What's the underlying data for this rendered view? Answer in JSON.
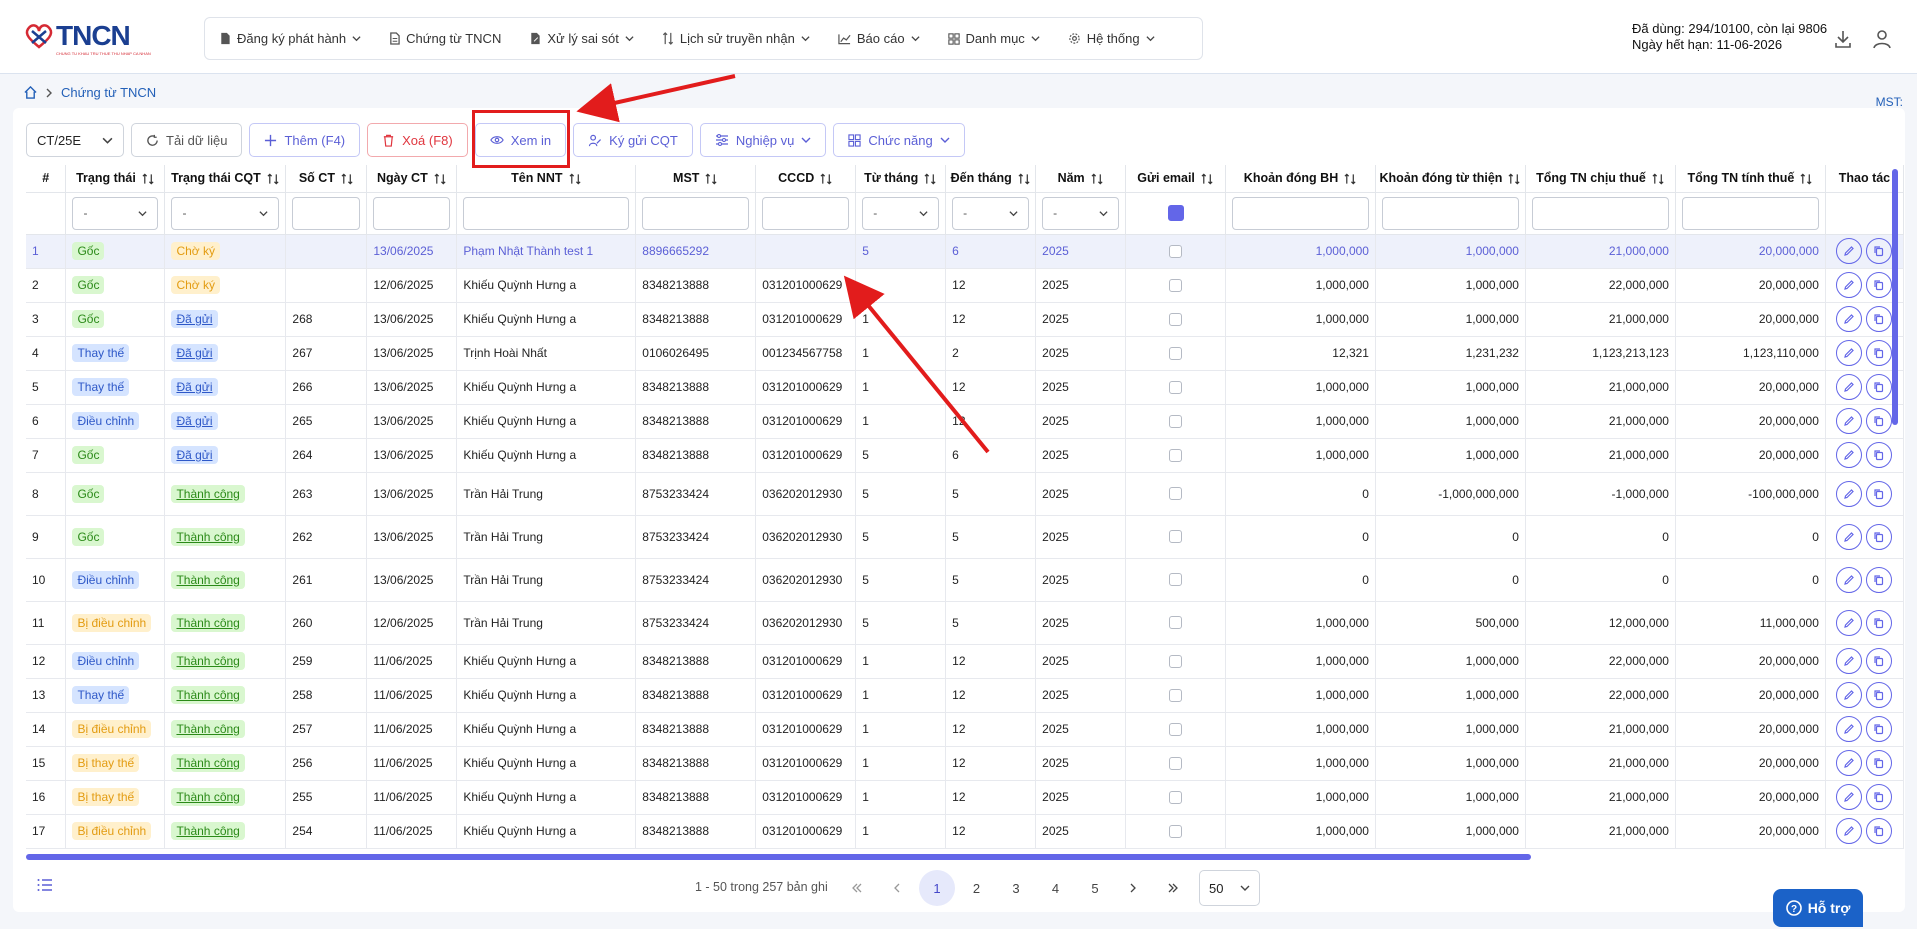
{
  "brand": {
    "name": "TNCN",
    "tagline": "CHUNG TU KHAU TRU THUE THU NHAP CA NHAN"
  },
  "nav": [
    {
      "label": "Đăng ký phát hành",
      "icon": "file-icon",
      "dropdown": true
    },
    {
      "label": "Chứng từ TNCN",
      "icon": "document-icon",
      "dropdown": false
    },
    {
      "label": "Xử lý sai sót",
      "icon": "file-edit-icon",
      "dropdown": true
    },
    {
      "label": "Lịch sử truyền nhận",
      "icon": "arrows-updown-icon",
      "dropdown": true
    },
    {
      "label": "Báo cáo",
      "icon": "chart-icon",
      "dropdown": true
    },
    {
      "label": "Danh mục",
      "icon": "grid-icon",
      "dropdown": true
    },
    {
      "label": "Hệ thống",
      "icon": "gear-icon",
      "dropdown": true
    }
  ],
  "quota": {
    "line1": "Đã dùng: 294/10100, còn lại 9806",
    "line2": "Ngày hết hạn: 11-06-2026"
  },
  "breadcrumb": {
    "current": "Chứng từ TNCN"
  },
  "mst_label": "MST:",
  "toolbar": {
    "template": "CT/25E",
    "reload": "Tải dữ liệu",
    "add": "Thêm (F4)",
    "delete": "Xoá (F8)",
    "preview": "Xem in",
    "sign_send": "Ký gửi CQT",
    "business": "Nghiệp vụ",
    "functions": "Chức năng"
  },
  "columns": [
    "#",
    "Trạng thái",
    "Trạng thái CQT",
    "Số CT",
    "Ngày CT",
    "Tên NNT",
    "MST",
    "CCCD",
    "Từ tháng",
    "Đến tháng",
    "Năm",
    "Gửi email",
    "Khoản đóng BH",
    "Khoản đóng từ thiện",
    "Tổng TN chịu thuế",
    "Tổng TN tính thuế",
    "Thao tác"
  ],
  "filter_placeholder": "-",
  "rows": [
    {
      "no": "1",
      "status": "Gốc",
      "cqt": "Chờ ký",
      "so": "",
      "ngay": "13/06/2025",
      "ten": "Phạm Nhật Thành test 1",
      "mst": "8896665292",
      "cccd": "",
      "tu": "5",
      "den": "6",
      "nam": "2025",
      "bh": "1,000,000",
      "tt": "1,000,000",
      "chiu": "21,000,000",
      "tinh": "20,000,000"
    },
    {
      "no": "2",
      "status": "Gốc",
      "cqt": "Chờ ký",
      "so": "",
      "ngay": "12/06/2025",
      "ten": "Khiếu Quỳnh Hưng a",
      "mst": "8348213888",
      "cccd": "031201000629",
      "tu": "",
      "den": "12",
      "nam": "2025",
      "bh": "1,000,000",
      "tt": "1,000,000",
      "chiu": "22,000,000",
      "tinh": "20,000,000"
    },
    {
      "no": "3",
      "status": "Gốc",
      "cqt": "Đã gửi",
      "so": "268",
      "ngay": "13/06/2025",
      "ten": "Khiếu Quỳnh Hưng a",
      "mst": "8348213888",
      "cccd": "031201000629",
      "tu": "1",
      "den": "12",
      "nam": "2025",
      "bh": "1,000,000",
      "tt": "1,000,000",
      "chiu": "21,000,000",
      "tinh": "20,000,000"
    },
    {
      "no": "4",
      "status": "Thay thế",
      "cqt": "Đã gửi",
      "so": "267",
      "ngay": "13/06/2025",
      "ten": "Trịnh Hoài Nhất",
      "mst": "0106026495",
      "cccd": "001234567758",
      "tu": "1",
      "den": "2",
      "nam": "2025",
      "bh": "12,321",
      "tt": "1,231,232",
      "chiu": "1,123,213,123",
      "tinh": "1,123,110,000"
    },
    {
      "no": "5",
      "status": "Thay thế",
      "cqt": "Đã gửi",
      "so": "266",
      "ngay": "13/06/2025",
      "ten": "Khiếu Quỳnh Hưng a",
      "mst": "8348213888",
      "cccd": "031201000629",
      "tu": "1",
      "den": "12",
      "nam": "2025",
      "bh": "1,000,000",
      "tt": "1,000,000",
      "chiu": "21,000,000",
      "tinh": "20,000,000"
    },
    {
      "no": "6",
      "status": "Điều chỉnh",
      "cqt": "Đã gửi",
      "so": "265",
      "ngay": "13/06/2025",
      "ten": "Khiếu Quỳnh Hưng a",
      "mst": "8348213888",
      "cccd": "031201000629",
      "tu": "1",
      "den": "12",
      "nam": "2025",
      "bh": "1,000,000",
      "tt": "1,000,000",
      "chiu": "21,000,000",
      "tinh": "20,000,000"
    },
    {
      "no": "7",
      "status": "Gốc",
      "cqt": "Đã gửi",
      "so": "264",
      "ngay": "13/06/2025",
      "ten": "Khiếu Quỳnh Hưng a",
      "mst": "8348213888",
      "cccd": "031201000629",
      "tu": "5",
      "den": "6",
      "nam": "2025",
      "bh": "1,000,000",
      "tt": "1,000,000",
      "chiu": "21,000,000",
      "tinh": "20,000,000"
    },
    {
      "no": "8",
      "status": "Gốc",
      "cqt": "Thành công",
      "so": "263",
      "ngay": "13/06/2025",
      "ten": "Trần Hải Trung",
      "mst": "8753233424",
      "cccd": "036202012930",
      "tu": "5",
      "den": "5",
      "nam": "2025",
      "bh": "0",
      "tt": "-1,000,000,000",
      "chiu": "-1,000,000",
      "tinh": "-100,000,000"
    },
    {
      "no": "9",
      "status": "Gốc",
      "cqt": "Thành công",
      "so": "262",
      "ngay": "13/06/2025",
      "ten": "Trần Hải Trung",
      "mst": "8753233424",
      "cccd": "036202012930",
      "tu": "5",
      "den": "5",
      "nam": "2025",
      "bh": "0",
      "tt": "0",
      "chiu": "0",
      "tinh": "0"
    },
    {
      "no": "10",
      "status": "Điều chỉnh",
      "cqt": "Thành công",
      "so": "261",
      "ngay": "13/06/2025",
      "ten": "Trần Hải Trung",
      "mst": "8753233424",
      "cccd": "036202012930",
      "tu": "5",
      "den": "5",
      "nam": "2025",
      "bh": "0",
      "tt": "0",
      "chiu": "0",
      "tinh": "0"
    },
    {
      "no": "11",
      "status": "Bị điều chỉnh",
      "cqt": "Thành công",
      "so": "260",
      "ngay": "12/06/2025",
      "ten": "Trần Hải Trung",
      "mst": "8753233424",
      "cccd": "036202012930",
      "tu": "5",
      "den": "5",
      "nam": "2025",
      "bh": "1,000,000",
      "tt": "500,000",
      "chiu": "12,000,000",
      "tinh": "11,000,000"
    },
    {
      "no": "12",
      "status": "Điều chỉnh",
      "cqt": "Thành công",
      "so": "259",
      "ngay": "11/06/2025",
      "ten": "Khiếu Quỳnh Hưng a",
      "mst": "8348213888",
      "cccd": "031201000629",
      "tu": "1",
      "den": "12",
      "nam": "2025",
      "bh": "1,000,000",
      "tt": "1,000,000",
      "chiu": "22,000,000",
      "tinh": "20,000,000"
    },
    {
      "no": "13",
      "status": "Thay thế",
      "cqt": "Thành công",
      "so": "258",
      "ngay": "11/06/2025",
      "ten": "Khiếu Quỳnh Hưng a",
      "mst": "8348213888",
      "cccd": "031201000629",
      "tu": "1",
      "den": "12",
      "nam": "2025",
      "bh": "1,000,000",
      "tt": "1,000,000",
      "chiu": "22,000,000",
      "tinh": "20,000,000"
    },
    {
      "no": "14",
      "status": "Bị điều chỉnh",
      "cqt": "Thành công",
      "so": "257",
      "ngay": "11/06/2025",
      "ten": "Khiếu Quỳnh Hưng a",
      "mst": "8348213888",
      "cccd": "031201000629",
      "tu": "1",
      "den": "12",
      "nam": "2025",
      "bh": "1,000,000",
      "tt": "1,000,000",
      "chiu": "21,000,000",
      "tinh": "20,000,000"
    },
    {
      "no": "15",
      "status": "Bị thay thế",
      "cqt": "Thành công",
      "so": "256",
      "ngay": "11/06/2025",
      "ten": "Khiếu Quỳnh Hưng a",
      "mst": "8348213888",
      "cccd": "031201000629",
      "tu": "1",
      "den": "12",
      "nam": "2025",
      "bh": "1,000,000",
      "tt": "1,000,000",
      "chiu": "21,000,000",
      "tinh": "20,000,000"
    },
    {
      "no": "16",
      "status": "Bị thay thế",
      "cqt": "Thành công",
      "so": "255",
      "ngay": "11/06/2025",
      "ten": "Khiếu Quỳnh Hưng a",
      "mst": "8348213888",
      "cccd": "031201000629",
      "tu": "1",
      "den": "12",
      "nam": "2025",
      "bh": "1,000,000",
      "tt": "1,000,000",
      "chiu": "21,000,000",
      "tinh": "20,000,000"
    },
    {
      "no": "17",
      "status": "Bị điều chỉnh",
      "cqt": "Thành công",
      "so": "254",
      "ngay": "11/06/2025",
      "ten": "Khiếu Quỳnh Hưng a",
      "mst": "8348213888",
      "cccd": "031201000629",
      "tu": "1",
      "den": "12",
      "nam": "2025",
      "bh": "1,000,000",
      "tt": "1,000,000",
      "chiu": "21,000,000",
      "tinh": "20,000,000"
    }
  ],
  "pagination": {
    "info": "1 - 50 trong 257 bản ghi",
    "pages": [
      "1",
      "2",
      "3",
      "4",
      "5"
    ],
    "current": "1",
    "page_size": "50"
  },
  "help": {
    "label": "Hỗ trợ"
  },
  "colors": {
    "accent": "#6366e8",
    "brand": "#1b3f91",
    "annotation": "#e21c1c"
  }
}
